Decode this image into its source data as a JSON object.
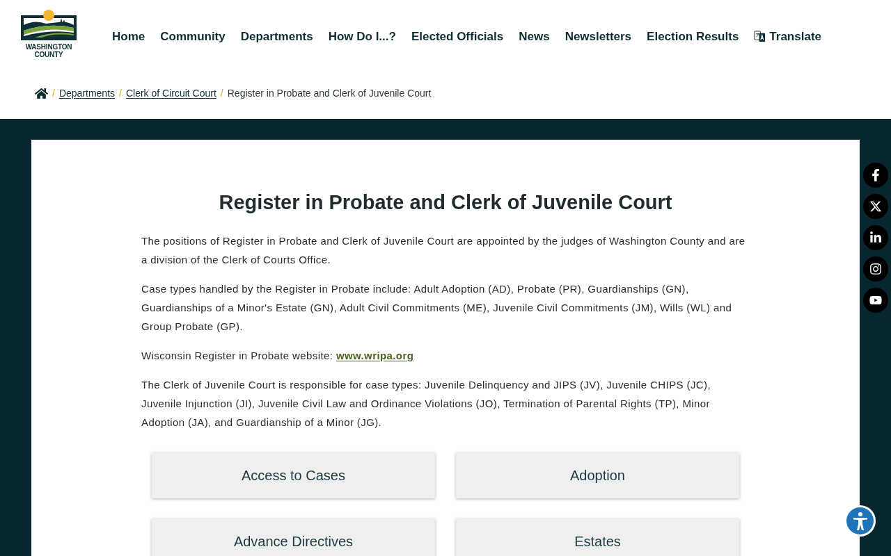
{
  "header": {
    "logo": {
      "line_1": "WASHINGTON",
      "line_2": "COUNTY"
    },
    "nav": [
      {
        "label": "Home",
        "kind": "link"
      },
      {
        "label": "Community",
        "kind": "link"
      },
      {
        "label": "Departments",
        "kind": "link"
      },
      {
        "label": "How Do I...?",
        "kind": "link"
      },
      {
        "label": "Elected Officials",
        "kind": "link"
      },
      {
        "label": "News",
        "kind": "link"
      },
      {
        "label": "Newsletters",
        "kind": "link"
      },
      {
        "label": "Election Results",
        "kind": "link"
      },
      {
        "label": "Translate",
        "kind": "translate"
      }
    ]
  },
  "breadcrumb": [
    {
      "separator": "/",
      "label": "Departments",
      "kind": "link"
    },
    {
      "separator": "/",
      "label": "Clerk of Circuit Court",
      "kind": "link"
    },
    {
      "separator": "/",
      "label": "Register in Probate and Clerk of Juvenile Court",
      "kind": "current"
    }
  ],
  "page": {
    "title": "Register in Probate and Clerk of Juvenile Court",
    "paragraphs": [
      {
        "text": "The positions of Register in Probate and Clerk of Juvenile Court are appointed by the judges of Washington County and are a division of the Clerk of Courts Office."
      },
      {
        "text": "Case types handled by the Register in Probate include: Adult Adoption (AD), Probate (PR), Guardianships (GN), Guardianships of a Minor's Estate (GN), Adult Civil Commitments (ME), Juvenile Civil Commitments (JM), Wills (WL) and Group Probate (GP)."
      },
      {
        "text": "Wisconsin Register in Probate website: ",
        "link": "www.wripa.org"
      },
      {
        "text": "The Clerk of Juvenile Court is responsible for case types: Juvenile Delinquency and JIPS (JV), Juvenile CHIPS (JC), Juvenile Injunction (JI), Juvenile Civil Law and Ordinance Violations (JO), Termination of Parental Rights (TP), Minor Adoption (JA), and Guardianship of a Minor (JG)."
      }
    ],
    "buttons": [
      "Access to Cases",
      "Adoption",
      "Advance Directives",
      "Estates"
    ]
  }
}
